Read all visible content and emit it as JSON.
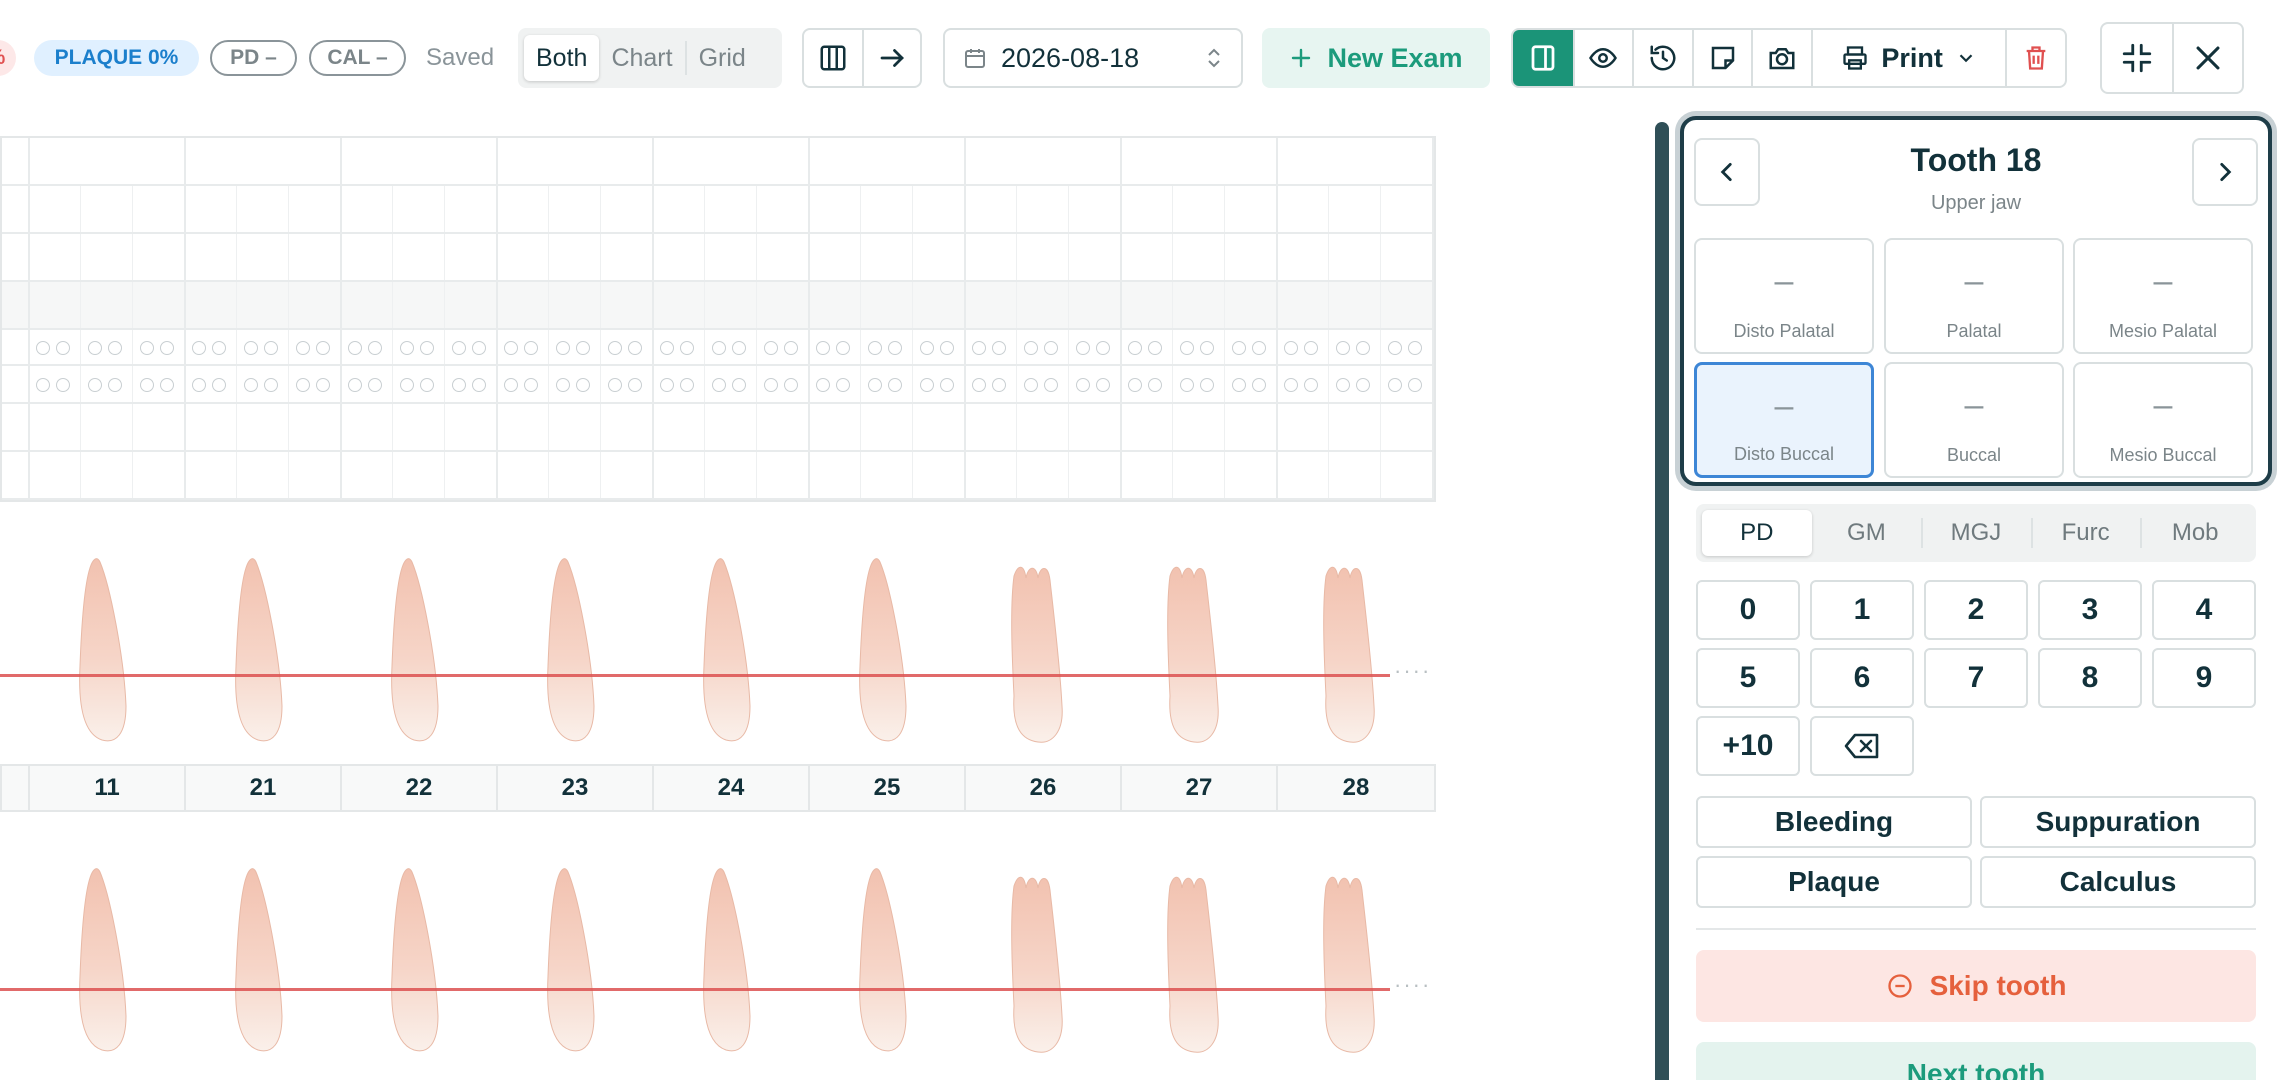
{
  "toolbar": {
    "partial_badge": "%",
    "plaque_badge": "PLAQUE 0%",
    "pd_badge": "PD –",
    "cal_badge": "CAL –",
    "saved_label": "Saved",
    "view_options": [
      "Both",
      "Chart",
      "Grid"
    ],
    "active_view": "Both",
    "date_value": "2026-08-18",
    "new_exam_label": "New Exam",
    "print_label": "Print"
  },
  "chart": {
    "tooth_numbers": [
      "11",
      "21",
      "22",
      "23",
      "24",
      "25",
      "26",
      "27",
      "28"
    ]
  },
  "panel": {
    "tooth_title": "Tooth 18",
    "tooth_subtitle": "Upper jaw",
    "sites": [
      {
        "label": "Disto Palatal",
        "value": "–"
      },
      {
        "label": "Palatal",
        "value": "–"
      },
      {
        "label": "Mesio Palatal",
        "value": "–"
      },
      {
        "label": "Disto Buccal",
        "value": "–"
      },
      {
        "label": "Buccal",
        "value": "–"
      },
      {
        "label": "Mesio Buccal",
        "value": "–"
      }
    ],
    "active_site": "Disto Buccal",
    "modes": [
      "PD",
      "GM",
      "MGJ",
      "Furc",
      "Mob"
    ],
    "active_mode": "PD",
    "keys": [
      "0",
      "1",
      "2",
      "3",
      "4",
      "5",
      "6",
      "7",
      "8",
      "9",
      "+10"
    ],
    "flags": [
      "Bleeding",
      "Suppuration",
      "Plaque",
      "Calculus"
    ],
    "skip_label": "Skip tooth",
    "next_label": "Next tooth"
  },
  "colors": {
    "accent": "#1b9478",
    "danger": "#e5603d",
    "active_site": "#3d86d6",
    "cej_line": "#dc5050"
  }
}
